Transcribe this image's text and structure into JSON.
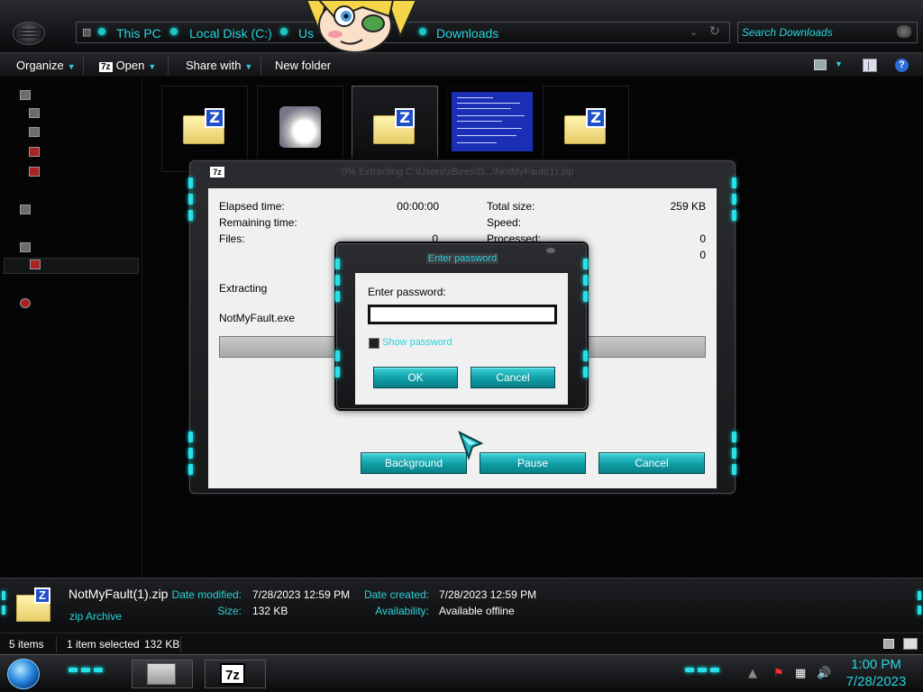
{
  "address": {
    "crumbs": [
      "This PC",
      "Local Disk (C:)",
      "Us",
      "Downloads"
    ],
    "search_placeholder": "Search Downloads"
  },
  "toolbar": {
    "organize": "Organize",
    "open": "Open",
    "open_badge": "7z",
    "share": "Share with",
    "new_folder": "New folder"
  },
  "progress": {
    "title_icon": "7z",
    "title": "0% Extracting C:\\Users\\xBees\\D...\\NotMyFault(1).zip",
    "elapsed_label": "Elapsed time:",
    "elapsed_value": "00:00:00",
    "remaining_label": "Remaining time:",
    "files_label": "Files:",
    "files_value": "0",
    "total_size_label": "Total size:",
    "total_size_value": "259 KB",
    "speed_label": "Speed:",
    "processed_label": "Processed:",
    "processed_value": "0",
    "extra_value": "0",
    "status": "Extracting",
    "current_file": "NotMyFault.exe",
    "progress_fraction": 0,
    "background_btn": "Background",
    "pause_btn": "Pause",
    "cancel_btn": "Cancel"
  },
  "password_dialog": {
    "title": "Enter password",
    "label": "Enter password:",
    "show_password": "Show password",
    "ok": "OK",
    "cancel": "Cancel"
  },
  "details": {
    "file_name": "NotMyFault(1).zip",
    "file_type": "zip Archive",
    "date_modified_label": "Date modified:",
    "date_modified": "7/28/2023 12:59 PM",
    "size_label": "Size:",
    "size": "132 KB",
    "date_created_label": "Date created:",
    "date_created": "7/28/2023 12:59 PM",
    "availability_label": "Availability:",
    "availability": "Available offline"
  },
  "status": {
    "items": "5 items",
    "selected": "1 item selected",
    "selected_size": "132 KB"
  },
  "taskbar": {
    "clock_time": "1:00 PM",
    "clock_date": "7/28/2023",
    "app_7z": "7z"
  },
  "colors": {
    "accent": "#2ad3dc",
    "button": "#0f9da5",
    "window_frame": "#2a2c30"
  }
}
